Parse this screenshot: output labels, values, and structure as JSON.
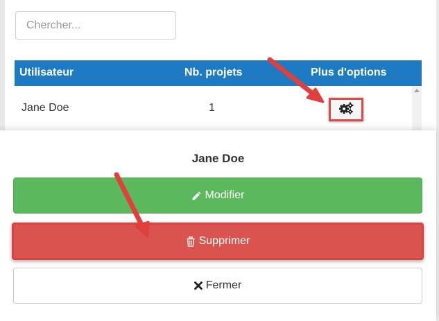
{
  "search": {
    "placeholder": "Chercher..."
  },
  "table": {
    "headers": {
      "user": "Utilisateur",
      "projects": "Nb. projets",
      "options": "Plus d'options"
    },
    "rows": [
      {
        "user": "Jane Doe",
        "projects": "1"
      }
    ]
  },
  "modal": {
    "title": "Jane Doe",
    "edit_label": "Modifier",
    "delete_label": "Supprimer",
    "close_label": "Fermer"
  },
  "colors": {
    "header_blue": "#1e7ac2",
    "edit_green": "#5cb85c",
    "delete_red": "#d9534f",
    "annotation_red": "#e0403d"
  },
  "icons": {
    "options": "gears-icon",
    "edit": "pencil-icon",
    "delete": "trash-icon",
    "close": "times-icon"
  }
}
